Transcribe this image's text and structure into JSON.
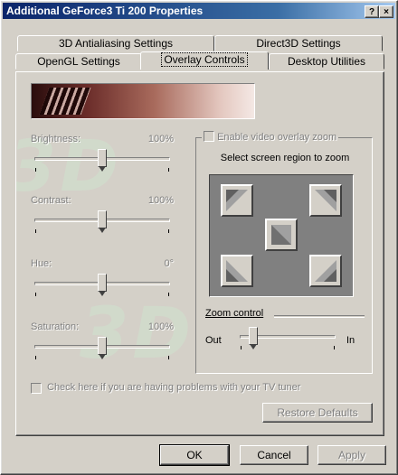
{
  "window": {
    "title": "Additional GeForce3 Ti 200 Properties",
    "help_glyph": "?",
    "close_glyph": "×"
  },
  "tabs_row1": [
    {
      "label": "3D Antialiasing Settings"
    },
    {
      "label": "Direct3D Settings"
    }
  ],
  "tabs_row2": [
    {
      "label": "OpenGL Settings"
    },
    {
      "label": "Overlay Controls",
      "active": true
    },
    {
      "label": "Desktop Utilities"
    }
  ],
  "sliders": [
    {
      "label": "Brightness:",
      "value": "100%",
      "position": 0.5
    },
    {
      "label": "Contrast:",
      "value": "100%",
      "position": 0.5
    },
    {
      "label": "Hue:",
      "value": "0°",
      "position": 0.5
    },
    {
      "label": "Saturation:",
      "value": "100%",
      "position": 0.5
    }
  ],
  "overlay_zoom": {
    "checkbox_label": "Enable video overlay zoom",
    "region_label": "Select screen region to zoom",
    "zoom_control_label": "Zoom control",
    "out_label": "Out",
    "in_label": "In",
    "zoom_position": 0.1
  },
  "tv_checkbox_label": "Check here if you are having problems with your TV tuner",
  "restore_label": "Restore Defaults",
  "watermark": {
    "top": "3D",
    "bottom": "3D"
  },
  "footer": {
    "ok_label": "OK",
    "cancel_label": "Cancel",
    "apply_label": "Apply"
  }
}
